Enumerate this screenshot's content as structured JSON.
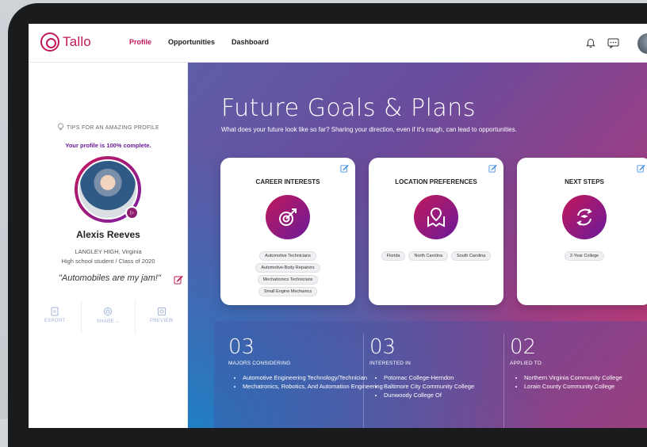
{
  "app": {
    "brand": "Tallo"
  },
  "nav": {
    "items": [
      {
        "label": "Profile",
        "active": true
      },
      {
        "label": "Opportunities"
      },
      {
        "label": "Dashboard"
      }
    ]
  },
  "sidebar": {
    "tips": "TIPS FOR AN AMAZING PROFILE",
    "completion": "Your profile is 100% complete.",
    "name": "Alexis Reeves",
    "school": "LANGLEY HIGH, Virginia",
    "grade": "High school student / Class of 2020",
    "quote": "\"Automobiles are my jam!\"",
    "actions": {
      "export": "EXPORT",
      "share": "SHARE ⌄",
      "preview": "PREVIEW"
    }
  },
  "main": {
    "title": "Future Goals & Plans",
    "subtitle": "What does your future look like so far? Sharing your direction, even if it's rough, can lead to opportunities.",
    "cards": [
      {
        "title": "CAREER INTERESTS",
        "icon": "target-arrow-icon",
        "tags": [
          "Automotive Technicians",
          "Automotive-Body Repairers",
          "Mechatronics Technicians",
          "Small Engine Mechanics"
        ]
      },
      {
        "title": "LOCATION PREFERENCES",
        "icon": "map-pin-icon",
        "tags": [
          "Florida",
          "North Carolina",
          "South Carolina"
        ]
      },
      {
        "title": "NEXT STEPS",
        "icon": "graduation-cycle-icon",
        "tags": [
          "2-Year College"
        ]
      }
    ],
    "stats": [
      {
        "num": "03",
        "label": "MAJORS CONSIDERING",
        "items": [
          "Automotive Engineering Technology/Technician",
          "Mechatronics, Robotics, And Automation Engineering"
        ]
      },
      {
        "num": "03",
        "label": "INTERESTED IN",
        "items": [
          "Potomac College-Herndon",
          "Baltimore City Community College",
          "Dunwoody College Of"
        ]
      },
      {
        "num": "02",
        "label": "APPLIED TO",
        "items": [
          "Northern Virginia Community College",
          "Lorain County Community College"
        ]
      }
    ]
  },
  "colors": {
    "accent": "#c2185b",
    "purple": "#6a1b9a"
  }
}
